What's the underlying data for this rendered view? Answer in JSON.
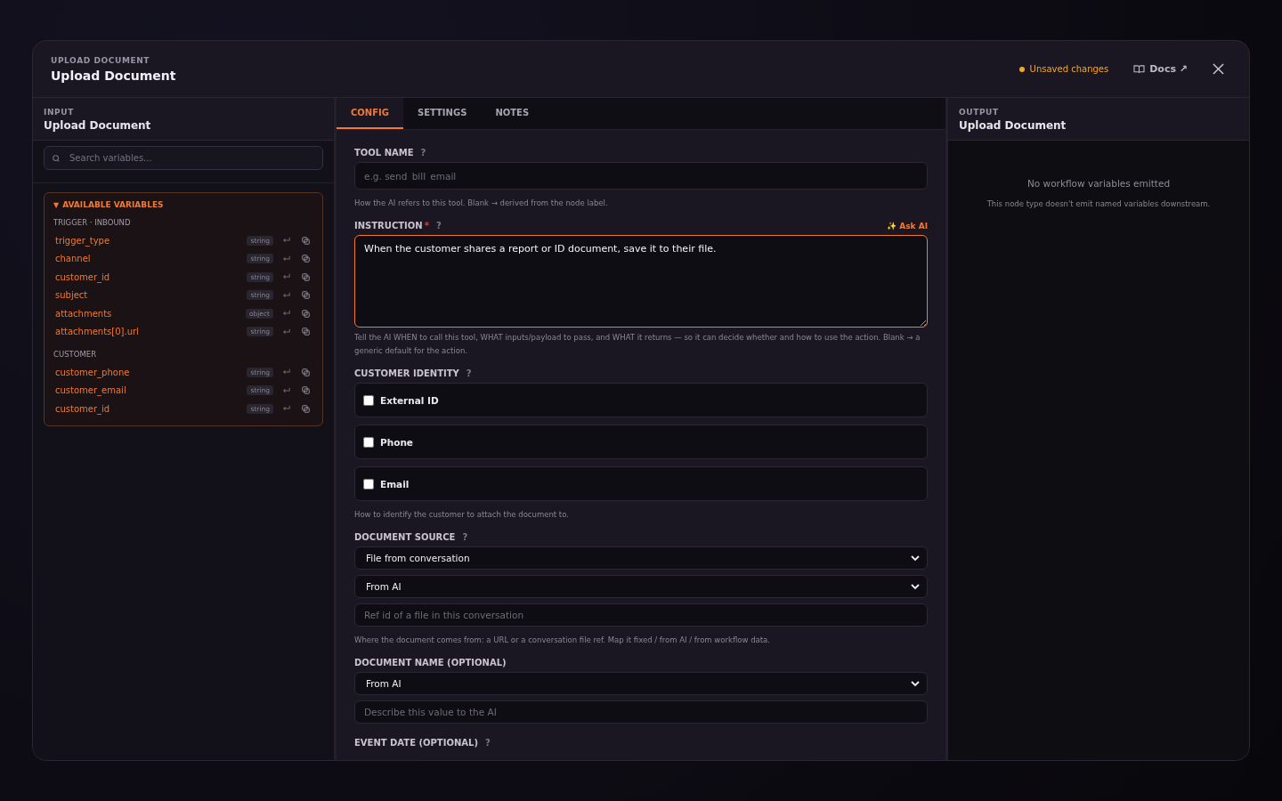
{
  "modal": {
    "eyebrow": "UPLOAD DOCUMENT",
    "title": "Upload Document",
    "status": "Unsaved changes",
    "docs_link": "Docs ↗"
  },
  "input_panel": {
    "eyebrow": "INPUT",
    "title": "Upload Document",
    "search": {
      "placeholder": "Search variables..."
    },
    "variables": {
      "toggle": "▼",
      "title": "AVAILABLE VARIABLES",
      "expanded": true,
      "groups": [
        {
          "title": "TRIGGER · INBOUND",
          "items": [
            {
              "name": "trigger_type",
              "type": "string"
            },
            {
              "name": "channel",
              "type": "string"
            },
            {
              "name": "customer_id",
              "type": "string"
            },
            {
              "name": "subject",
              "type": "string"
            },
            {
              "name": "attachments",
              "type": "object"
            },
            {
              "name": "attachments[0].url",
              "type": "string"
            }
          ]
        },
        {
          "title": "CUSTOMER",
          "items": [
            {
              "name": "customer_phone",
              "type": "string"
            },
            {
              "name": "customer_email",
              "type": "string"
            },
            {
              "name": "customer_id",
              "type": "string"
            }
          ]
        }
      ]
    }
  },
  "tabs": [
    {
      "label": "CONFIG",
      "selected": true
    },
    {
      "label": "SETTINGS",
      "selected": false
    },
    {
      "label": "NOTES",
      "selected": false
    }
  ],
  "config": {
    "fields": [
      {
        "kind": "text",
        "label": "TOOL NAME",
        "help": "?",
        "placeholder": "e.g. send_bill_email",
        "hint": "How the AI refers to this tool. Blank → derived from the node label."
      },
      {
        "kind": "textarea",
        "label": "INSTRUCTION",
        "required": true,
        "required_mark": "*",
        "help": "?",
        "action": "✨ Ask AI",
        "value": "When the customer shares a report or ID document, save it to their file.",
        "hint": "Tell the AI WHEN to call this tool, WHAT inputs/payload to pass, and WHAT it returns — so it can decide whether and how to use the action. Blank → a generic default for the action."
      },
      {
        "kind": "checkboxes",
        "label": "CUSTOMER IDENTITY",
        "help": "?",
        "options": [
          {
            "label": "External ID",
            "checked": false
          },
          {
            "label": "Phone",
            "checked": false
          },
          {
            "label": "Email",
            "checked": false
          }
        ],
        "hint": "How to identify the customer to attach the document to."
      },
      {
        "kind": "mapped",
        "label": "DOCUMENT SOURCE",
        "help": "?",
        "selects": [
          "File from conversation",
          "From AI"
        ],
        "placeholder": "Ref id of a file in this conversation",
        "hint": "Where the document comes from: a URL or a conversation file ref. Map it fixed / from AI / from workflow data."
      },
      {
        "kind": "mapped",
        "label": "DOCUMENT NAME (OPTIONAL)",
        "selects": [
          "From AI"
        ],
        "placeholder": "Describe this value to the AI"
      },
      {
        "kind": "heading",
        "label": "EVENT DATE (OPTIONAL)",
        "help": "?"
      }
    ]
  },
  "output_panel": {
    "eyebrow": "OUTPUT",
    "title": "Upload Document",
    "empty_title": "No workflow variables emitted",
    "empty_text": "This node type doesn't emit named variables downstream."
  }
}
